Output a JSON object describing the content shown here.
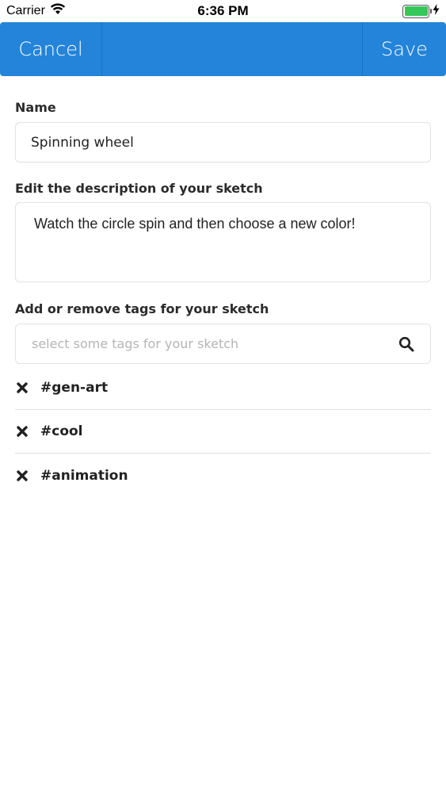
{
  "status_bar": {
    "carrier": "Carrier",
    "time": "6:36 PM",
    "battery_color": "#34c759"
  },
  "nav": {
    "cancel_label": "Cancel",
    "save_label": "Save",
    "background": "#2384d9"
  },
  "form": {
    "name_label": "Name",
    "name_value": "Spinning wheel",
    "description_label": "Edit the description of your sketch",
    "description_value": "Watch the circle spin and then choose a new color!",
    "tags_label": "Add or remove tags for your sketch",
    "tags_placeholder": "select some tags for your sketch",
    "search_icon": "search-icon"
  },
  "tags": [
    {
      "label": "#gen-art",
      "remove_icon": "close-icon"
    },
    {
      "label": "#cool",
      "remove_icon": "close-icon"
    },
    {
      "label": "#animation",
      "remove_icon": "close-icon"
    }
  ]
}
